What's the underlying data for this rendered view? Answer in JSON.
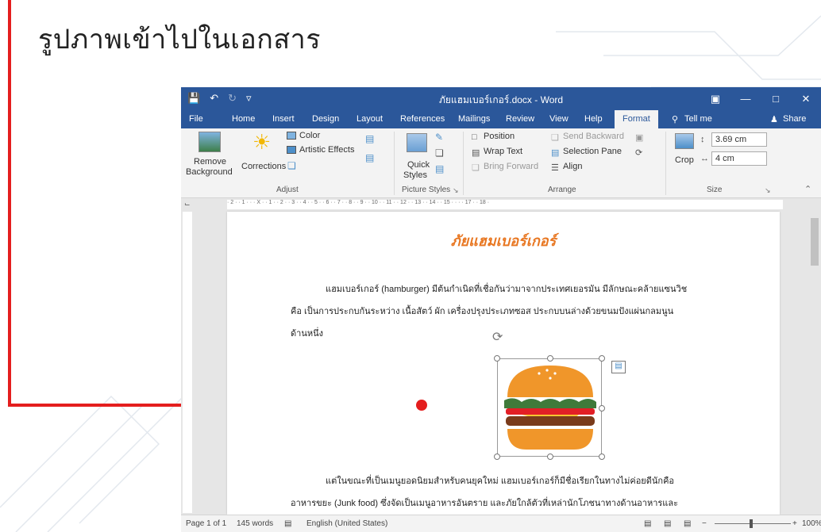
{
  "slide_title": "รูปภาพเข้าไปในเอกสาร",
  "word": {
    "title": "ภัยแฮมเบอร์เกอร์.docx - Word",
    "tabs": [
      {
        "label": "File"
      },
      {
        "label": "Home"
      },
      {
        "label": "Insert"
      },
      {
        "label": "Design"
      },
      {
        "label": "Layout"
      },
      {
        "label": "References"
      },
      {
        "label": "Mailings"
      },
      {
        "label": "Review"
      },
      {
        "label": "View"
      },
      {
        "label": "Help"
      },
      {
        "label": "Format"
      }
    ],
    "tell_me": "Tell me",
    "share": "Share",
    "ribbon": {
      "remove_bg_1": "Remove",
      "remove_bg_2": "Background",
      "corrections": "Corrections",
      "color": "Color",
      "artistic": "Artistic Effects",
      "adjust": "Adjust",
      "quick_1": "Quick",
      "quick_2": "Styles",
      "picture_styles": "Picture Styles",
      "position": "Position",
      "wrap_text": "Wrap Text",
      "bring_forward": "Bring Forward",
      "send_backward": "Send Backward",
      "selection_pane": "Selection Pane",
      "align": "Align",
      "arrange": "Arrange",
      "crop": "Crop",
      "height": "3.69 cm",
      "width": "4 cm",
      "size": "Size"
    },
    "ruler_text": "· 2 · · 1 · · · X · · 1 · · 2 · · 3 · · 4 · · 5 · · 6 · · 7 · · 8 · · 9 · · 10 · · 11 · · 12 · · 13 · · 14 · · 15 · · · · 17 · · 18 ·",
    "doc": {
      "heading": "ภัยแฮมเบอร์เกอร์",
      "p1_l1": "แฮมเบอร์เกอร์ (hamburger) มีต้นกำเนิดที่เชื่อกันว่ามาจากประเทศเยอรมัน มีลักษณะคล้ายแซนวิช",
      "p1_l2": "คือ เป็นการประกบกันระหว่าง เนื้อสัตว์ ผัก เครื่องปรุงประเภทซอส ประกบบนล่างด้วยขนมปังแผ่นกลมนูน",
      "p1_l3": "ด้านหนึ่ง",
      "p2_l1": "แต่ในขณะที่เป็นเมนูยอดนิยมสำหรับคนยุคใหม่  แฮมเบอร์เกอร์ก็มีชื่อเรียกในทางไม่ค่อยดีนักคือ",
      "p2_l2": "อาหารขยะ (Junk food) ซึ่งจัดเป็นเมนูอาหารอันตราย และภัยใกล้ตัวที่เหล่านักโภชนาทางด้านอาหารและ"
    },
    "status": {
      "page": "Page 1 of 1",
      "words": "145 words",
      "lang": "English (United States)",
      "zoom": "100%"
    }
  },
  "colors": {
    "word_blue": "#2b579a",
    "accent_red": "#e41e1e",
    "heading_orange": "#e87722"
  }
}
